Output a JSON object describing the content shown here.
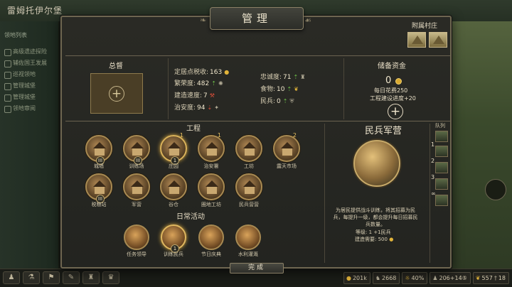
{
  "background": {
    "title": "雷姆托伊尔堡",
    "left_menu_head": "领地列表",
    "left_menu": [
      "高级遗迹探险",
      "辅佐国王发展",
      "巡视领地",
      "管理城堡",
      "管理城堡",
      "领地审阅"
    ]
  },
  "panel": {
    "title": "管理",
    "village_label": "附属村庄",
    "done_label": "完成"
  },
  "governor": {
    "title": "总督"
  },
  "stats": {
    "tax_label": "定居点税收:",
    "tax_value": "163",
    "prosperity_label": "繁荣度:",
    "prosperity_value": "482",
    "construction_label": "建造速度:",
    "construction_value": "7",
    "security_label": "治安度:",
    "security_value": "94",
    "loyalty_label": "忠诚度:",
    "loyalty_value": "71",
    "food_label": "食物:",
    "food_value": "10",
    "militia_label": "民兵:",
    "militia_value": "0"
  },
  "reserve": {
    "title": "储备资金",
    "value": "0",
    "daily_cost": "每日花费250",
    "construction_bonus": "工程建设进度+20"
  },
  "projects": {
    "title": "工程",
    "buildings": [
      {
        "name": "城墙",
        "level": "III",
        "number": ""
      },
      {
        "name": "训练场",
        "level": "III",
        "number": ""
      },
      {
        "name": "庄园",
        "level": "1",
        "number": "1"
      },
      {
        "name": "治安署",
        "level": "",
        "number": "1"
      },
      {
        "name": "工坊",
        "level": "",
        "number": ""
      },
      {
        "name": "露天市场",
        "level": "",
        "number": "2"
      },
      {
        "name": "税粮站",
        "level": "III",
        "number": ""
      },
      {
        "name": "军营",
        "level": "",
        "number": ""
      },
      {
        "name": "谷仓",
        "level": "",
        "number": ""
      },
      {
        "name": "圈地工坊",
        "level": "",
        "number": ""
      },
      {
        "name": "民兵营营",
        "level": "",
        "number": ""
      }
    ]
  },
  "daily": {
    "title": "日常活动",
    "activities": [
      {
        "name": "任务领导",
        "level": ""
      },
      {
        "name": "训练民兵",
        "level": "1"
      },
      {
        "name": "节日庆典",
        "level": ""
      },
      {
        "name": "水利灌溉",
        "level": ""
      }
    ]
  },
  "militia": {
    "title": "民兵军营",
    "description": "为居民提供战斗训练，将其招募为民兵，每提升一级，都会提升每日招募民兵数量。",
    "level": "等级: 1 +1民兵",
    "cost": "建造需要: 500"
  },
  "queue": {
    "label": "队列",
    "numbers": [
      "1",
      "2",
      "3",
      "∞"
    ]
  },
  "status_bar": {
    "gold": "201k",
    "horses": "2668",
    "morale": "40%",
    "troops": "206+14⑤",
    "food": "557",
    "extra": "18"
  },
  "colors": {
    "panel_bg": "#232420",
    "border_gold": "#6e6650",
    "gold_icon": "#e2b43a",
    "increase_green": "#6fc34a",
    "decrease_red": "#e0503a"
  }
}
